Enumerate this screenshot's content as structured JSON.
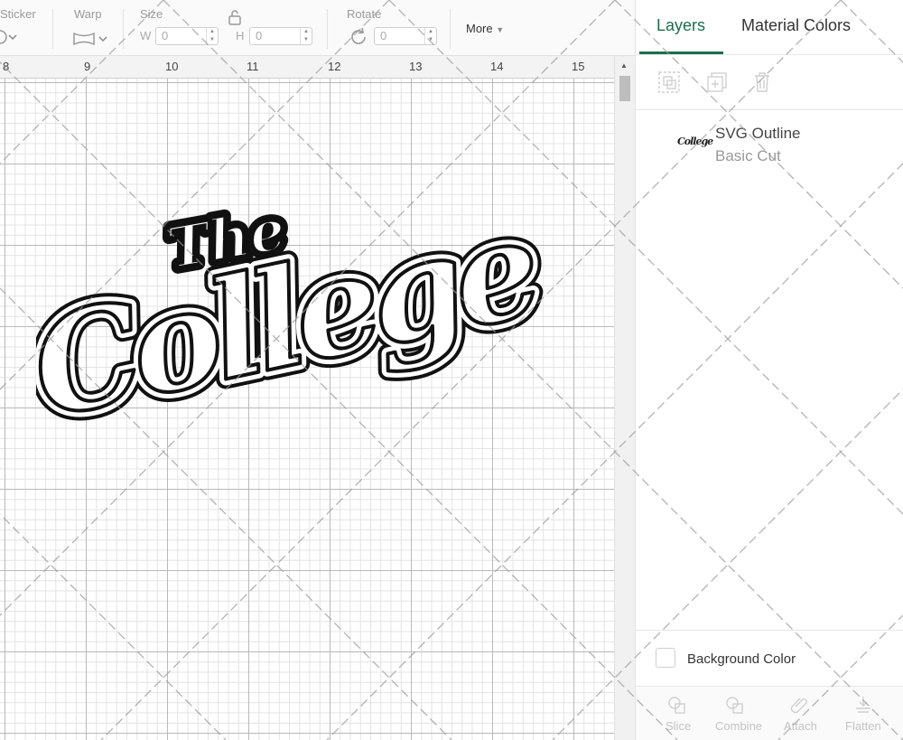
{
  "toolbar": {
    "sticker_label": "Sticker",
    "warp_label": "Warp",
    "size_label": "Size",
    "width_label": "W",
    "width_value": "0",
    "height_label": "H",
    "height_value": "0",
    "rotate_label": "Rotate",
    "rotate_value": "0",
    "more_label": "More"
  },
  "ruler": {
    "numbers": [
      "8",
      "9",
      "10",
      "11",
      "12",
      "13",
      "14",
      "15"
    ]
  },
  "artwork": {
    "line1": "The",
    "line2": "College"
  },
  "panel": {
    "tabs": [
      "Layers",
      "Material Colors"
    ],
    "active_tab": "Layers",
    "layer": {
      "thumb_text": "College",
      "name": "SVG Outline",
      "operation": "Basic Cut"
    },
    "background_color_label": "Background Color",
    "bottom_tools": [
      "Slice",
      "Combine",
      "Attach",
      "Flatten"
    ]
  },
  "colors": {
    "accent": "#1a6f4d"
  }
}
